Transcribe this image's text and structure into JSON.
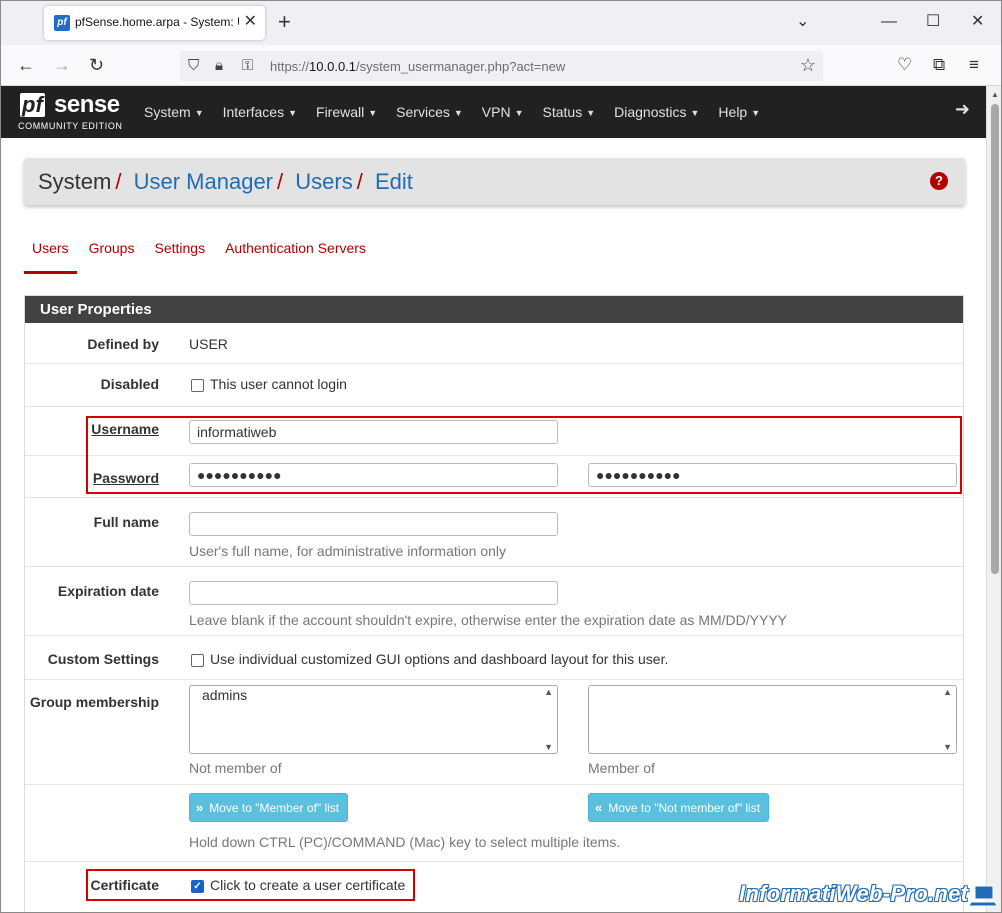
{
  "browser": {
    "tab_title": "pfSense.home.arpa - System: U",
    "tab_favicon": "pf",
    "url_prefix": "https://",
    "url_host": "10.0.0.1",
    "url_path": "/system_usermanager.php?act=new"
  },
  "navbar": {
    "logo_pf": "pf",
    "logo_sense": "sense",
    "logo_sub": "COMMUNITY EDITION",
    "menu": [
      "System",
      "Interfaces",
      "Firewall",
      "Services",
      "VPN",
      "Status",
      "Diagnostics",
      "Help"
    ]
  },
  "breadcrumb": {
    "root": "System",
    "links": [
      "User Manager",
      "Users",
      "Edit"
    ],
    "help": "?"
  },
  "subtabs": [
    "Users",
    "Groups",
    "Settings",
    "Authentication Servers"
  ],
  "panel": {
    "title": "User Properties",
    "defined_by": {
      "label": "Defined by",
      "value": "USER"
    },
    "disabled": {
      "label": "Disabled",
      "checkbox_label": "This user cannot login",
      "checked": false
    },
    "username": {
      "label": "Username",
      "value": "informatiweb"
    },
    "password": {
      "label": "Password",
      "value": "●●●●●●●●●●",
      "confirm": "●●●●●●●●●●"
    },
    "full_name": {
      "label": "Full name",
      "value": "",
      "hint": "User's full name, for administrative information only"
    },
    "expiration": {
      "label": "Expiration date",
      "value": "",
      "hint": "Leave blank if the account shouldn't expire, otherwise enter the expiration date as MM/DD/YYYY"
    },
    "custom": {
      "label": "Custom Settings",
      "checkbox_label": "Use individual customized GUI options and dashboard layout for this user.",
      "checked": false
    },
    "group": {
      "label": "Group membership",
      "not_member_options": [
        "admins"
      ],
      "member_options": [],
      "not_member_caption": "Not member of",
      "member_caption": "Member of",
      "move_to_member": "Move to \"Member of\" list",
      "move_to_not_member": "Move to \"Not member of\" list",
      "hint": "Hold down CTRL (PC)/COMMAND (Mac) key to select multiple items."
    },
    "certificate": {
      "label": "Certificate",
      "checkbox_label": "Click to create a user certificate",
      "checked": true
    }
  },
  "watermark": "InformatiWeb-Pro.net"
}
